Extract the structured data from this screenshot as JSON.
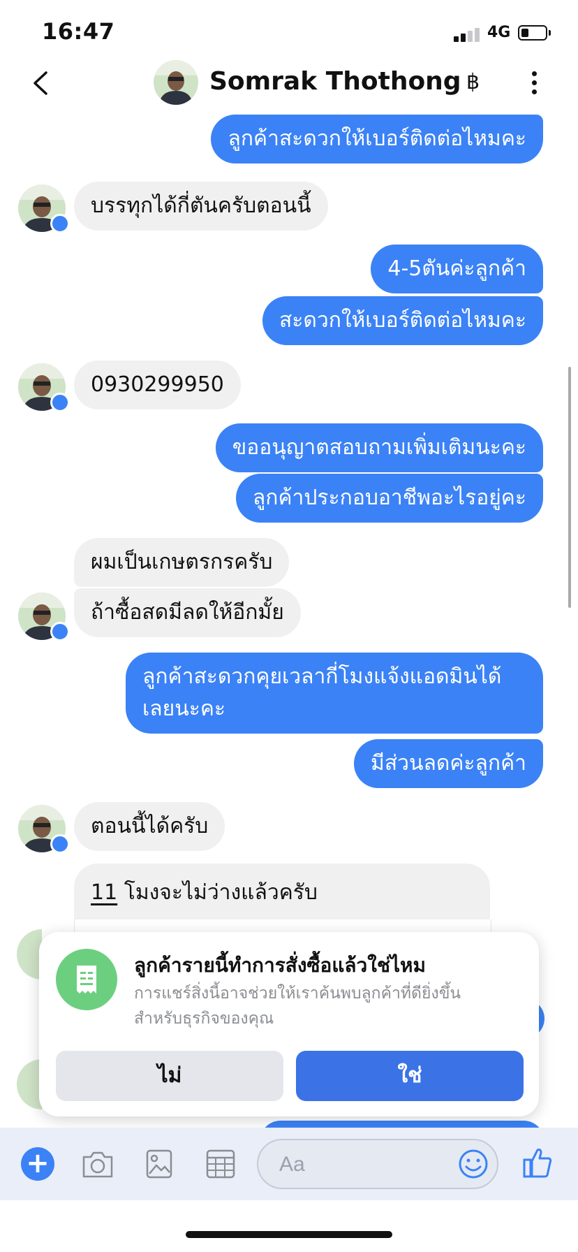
{
  "status_bar": {
    "time": "16:47",
    "network": "4G"
  },
  "header": {
    "contact_name": "Somrak Thothong",
    "currency_symbol": "฿"
  },
  "messages": {
    "m1": "ลูกค้าสะดวกให้เบอร์ติดต่อไหมคะ",
    "m2": "บรรทุกได้กี่ตันครับตอนนี้",
    "m3": "4-5ตันค่ะลูกค้า",
    "m4": "สะดวกให้เบอร์ติดต่อไหมคะ",
    "m5": "0930299950",
    "m6": "ขออนุญาตสอบถามเพิ่มเติมนะคะ",
    "m7": "ลูกค้าประกอบอาชีพอะไรอยู่คะ",
    "m8": "ผมเป็นเกษตรกรครับ",
    "m9": "ถ้าซื้อสดมีลดให้อีกมั้ย",
    "m10": "ลูกค้าสะดวกคุยเวลากี่โมงแจ้งแอดมินได้เลยนะคะ",
    "m11": "มีส่วนลดค่ะลูกค้า",
    "m12": "ตอนนี้ได้ครับ",
    "m13_num": "11",
    "m13_rest": " โมงจะไม่ว่างแล้วครับ"
  },
  "prompt": {
    "title": "ลูกค้ารายนี้ทำการสั่งซื้อแล้วใช่ไหม",
    "description": "การแชร์สิ่งนี้อาจช่วยให้เราค้นพบลูกค้าที่ดียิ่งขึ้นสำหรับธุรกิจของคุณ",
    "no_label": "ไม่",
    "yes_label": "ใช่"
  },
  "composer": {
    "placeholder": "Aa"
  },
  "colors": {
    "accent": "#3b82f6",
    "incoming_bubble": "#f0f0f0",
    "prompt_icon": "#6ccf7f"
  }
}
